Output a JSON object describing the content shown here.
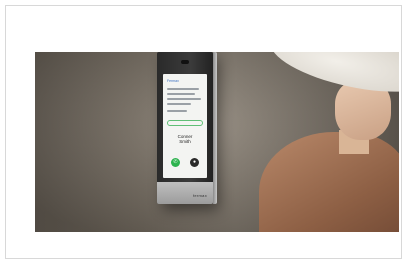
{
  "screen": {
    "app_label": "Fermax",
    "caller_line1": "Conner",
    "caller_line2": "Smith"
  },
  "device_brand": "fermax",
  "colors": {
    "accept": "#2db34f",
    "decline": "#2a2a2a",
    "coat": "#8d5f44"
  }
}
